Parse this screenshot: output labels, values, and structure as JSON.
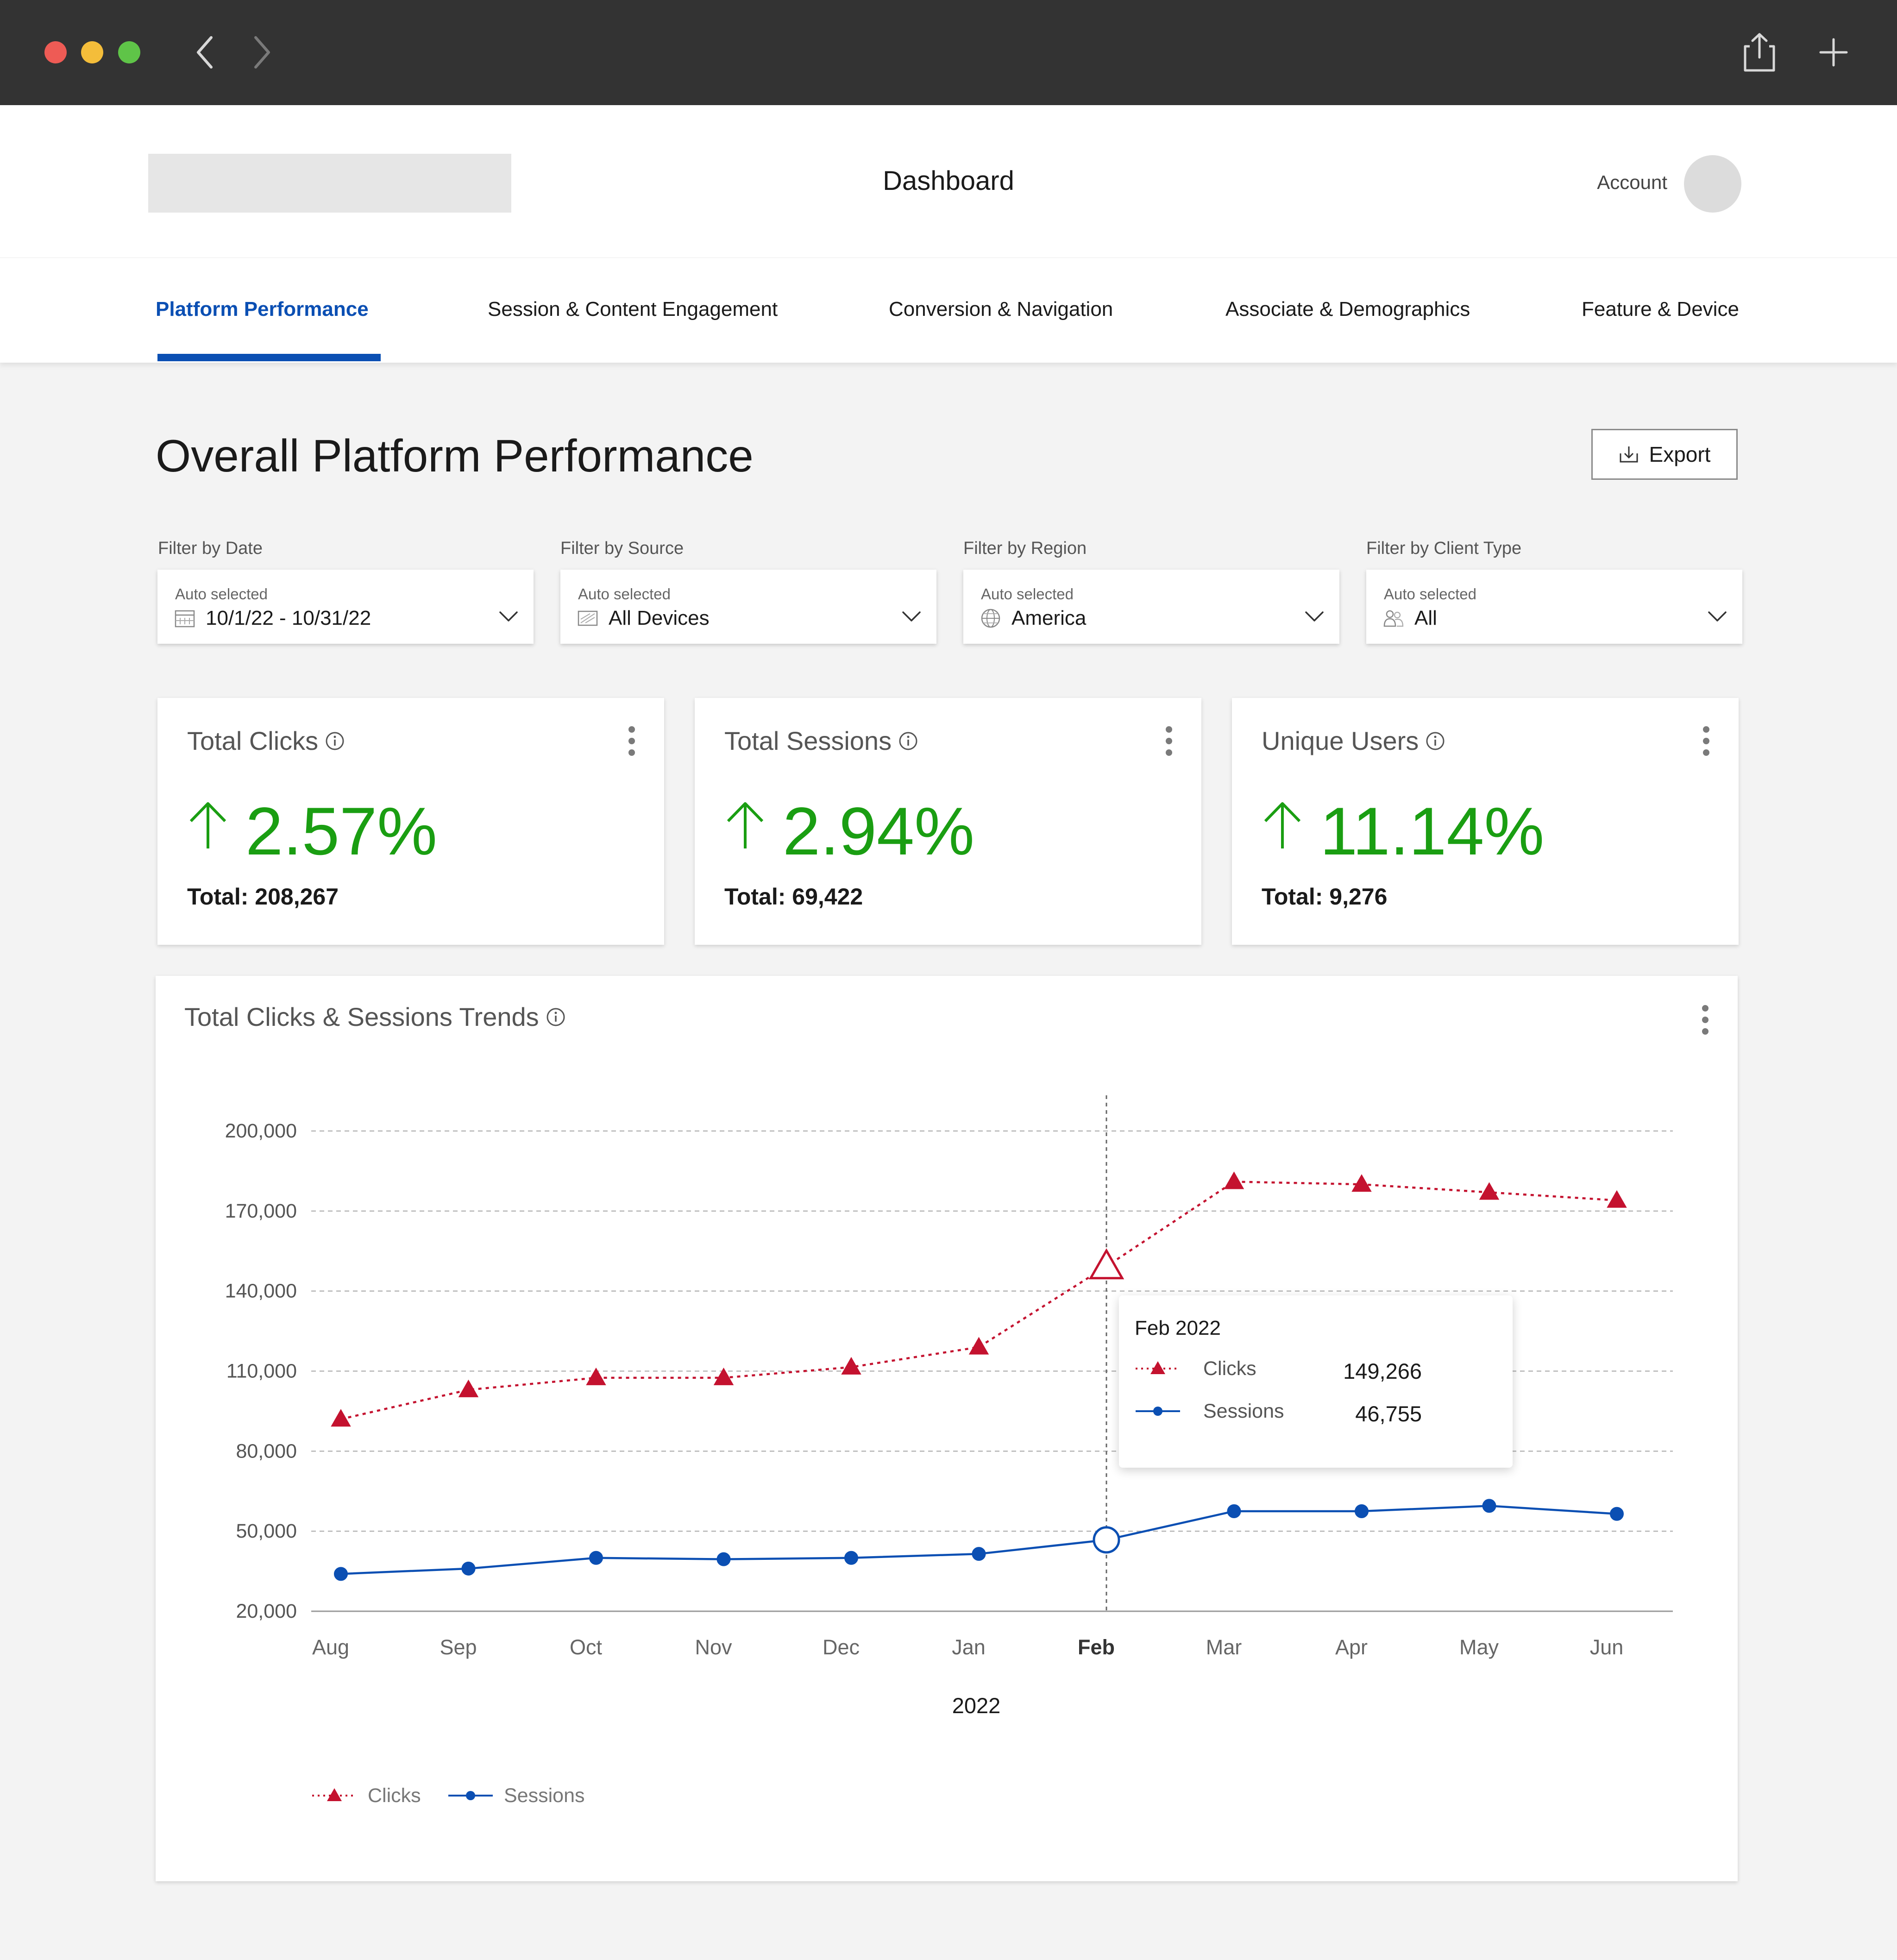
{
  "header": {
    "title": "Dashboard",
    "account_label": "Account"
  },
  "tabs": [
    {
      "label": "Platform Performance",
      "active": true
    },
    {
      "label": "Session & Content Engagement",
      "active": false
    },
    {
      "label": "Conversion & Navigation",
      "active": false
    },
    {
      "label": "Associate & Demographics",
      "active": false
    },
    {
      "label": "Feature & Device",
      "active": false
    }
  ],
  "section": {
    "title": "Overall Platform Performance",
    "export_label": "Export"
  },
  "filters": [
    {
      "label": "Filter by Date",
      "auto": "Auto selected",
      "value": "10/1/22 - 10/31/22",
      "icon": "calendar-icon"
    },
    {
      "label": "Filter by Source",
      "auto": "Auto selected",
      "value": "All Devices",
      "icon": "devices-icon"
    },
    {
      "label": "Filter by Region",
      "auto": "Auto selected",
      "value": "America",
      "icon": "globe-icon"
    },
    {
      "label": "Filter by Client Type",
      "auto": "Auto selected",
      "value": "All",
      "icon": "users-icon"
    }
  ],
  "kpis": [
    {
      "title": "Total Clicks",
      "change": "2.57%",
      "total": "Total: 208,267"
    },
    {
      "title": "Total Sessions",
      "change": "2.94%",
      "total": "Total: 69,422"
    },
    {
      "title": "Unique Users",
      "change": "11.14%",
      "total": "Total: 9,276"
    }
  ],
  "colors": {
    "accent": "#0b4fb3",
    "positive": "#1a9e12",
    "clicks": "#c4122f",
    "sessions": "#0b4fb3"
  },
  "chart_title": "Total Clicks & Sessions Trends",
  "tooltip": {
    "title": "Feb 2022",
    "rows": [
      {
        "name": "Clicks",
        "value": "149,266"
      },
      {
        "name": "Sessions",
        "value": "46,755"
      }
    ]
  },
  "chart_data": {
    "type": "line",
    "title": "Total Clicks & Sessions Trends",
    "xlabel": "2022",
    "ylabel": "",
    "categories": [
      "Aug",
      "Sep",
      "Oct",
      "Nov",
      "Dec",
      "Jan",
      "Feb",
      "Mar",
      "Apr",
      "May",
      "Jun"
    ],
    "highlight_category": "Feb",
    "ylim": [
      20000,
      200000
    ],
    "yticks": [
      20000,
      50000,
      80000,
      110000,
      140000,
      170000,
      200000
    ],
    "ytick_labels": [
      "20,000",
      "50,000",
      "80,000",
      "110,000",
      "140,000",
      "170,000",
      "200,000"
    ],
    "grid": true,
    "legend": "bottom-left",
    "series": [
      {
        "name": "Clicks",
        "style": "dotted-triangle",
        "color": "#c4122f",
        "values": [
          92000,
          103000,
          107500,
          107500,
          111500,
          119000,
          149266,
          181000,
          180000,
          177000,
          174000
        ]
      },
      {
        "name": "Sessions",
        "style": "solid-circle",
        "color": "#0b4fb3",
        "values": [
          34000,
          36000,
          40000,
          39500,
          40000,
          41500,
          46755,
          57500,
          57500,
          59500,
          56500
        ]
      }
    ]
  }
}
